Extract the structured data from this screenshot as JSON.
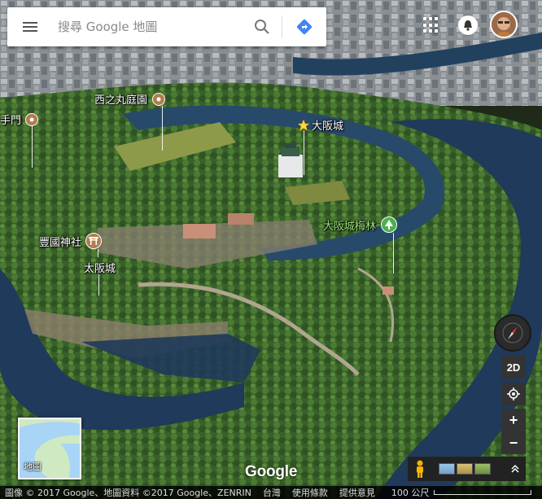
{
  "search": {
    "placeholder": "搜尋 Google 地圖",
    "menu_icon": "hamburger-menu-icon",
    "search_icon": "magnifier-icon",
    "directions_icon": "directions-diamond-icon"
  },
  "header": {
    "apps_icon": "apps-grid-icon",
    "notifications_icon": "bell-icon",
    "avatar_icon": "user-avatar"
  },
  "places": {
    "nishinomaru": "西之丸庭園",
    "gate": "手門",
    "osaka_castle": "大阪城",
    "plum_grove": "大阪城梅林",
    "hokoku_shrine": "豐國神社",
    "osaka_castle_2": "太阪城"
  },
  "controls": {
    "toggle_2d": "2D",
    "zoom_in": "+",
    "zoom_out": "−",
    "compass_icon": "compass-icon",
    "location_icon": "my-location-icon",
    "pegman_icon": "pegman-icon",
    "expand_icon": "chevron-up-icon"
  },
  "thumbnail": {
    "label": "地圖"
  },
  "logo": "Google",
  "attribution": {
    "imagery": "圖像 © 2017 Google、地圖資料 ©2017 Google、ZENRIN",
    "region": "台灣",
    "terms": "使用條款",
    "feedback": "提供意見",
    "scale": "100 公尺"
  },
  "colors": {
    "water": "#1f3a5a",
    "greenery": "#3f6a2a",
    "poi_brown": "#b07d4f",
    "poi_green": "#4caf50",
    "directions_blue": "#4285f4"
  }
}
